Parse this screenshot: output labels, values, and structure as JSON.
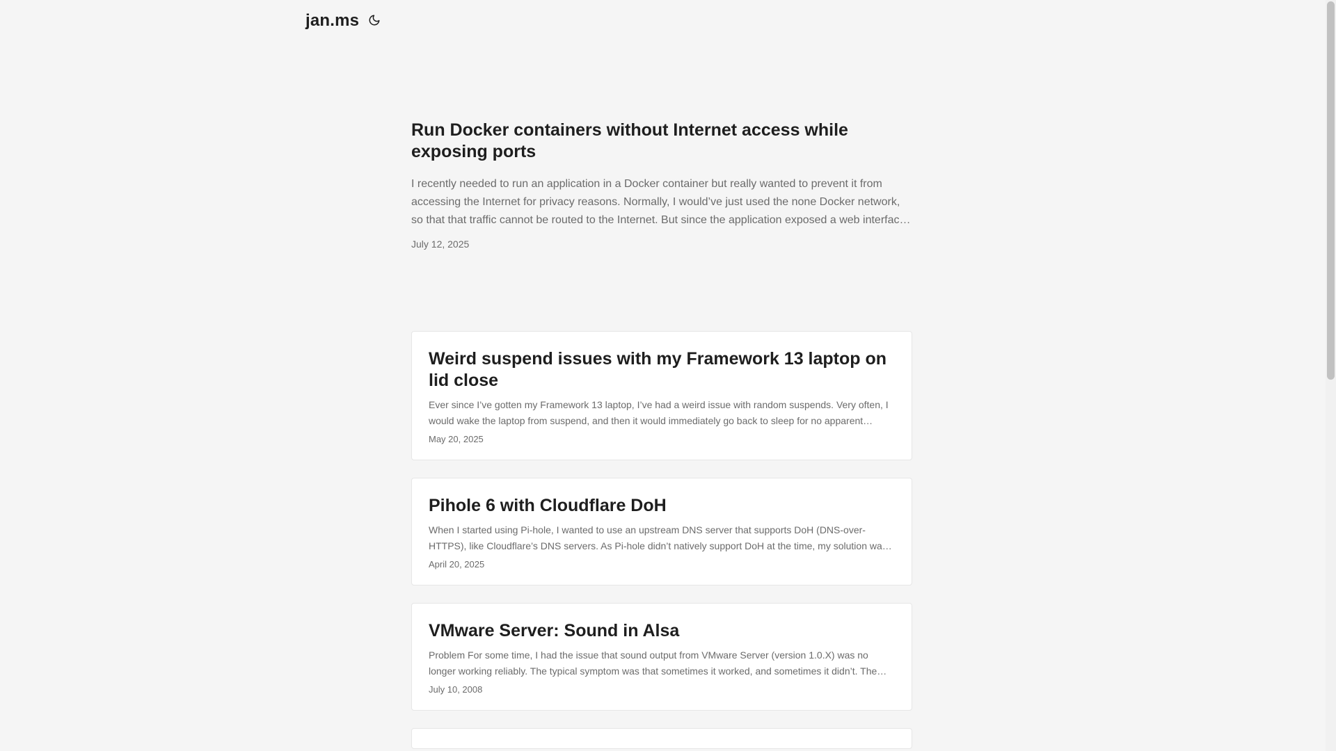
{
  "site": {
    "logo": "jan.ms",
    "theme_toggle_icon": "moon-icon"
  },
  "featured": {
    "title": "Run Docker containers without Internet access while exposing ports",
    "excerpt": "I recently needed to run an application in a Docker container but really wanted to prevent it from accessing the Internet for privacy reasons. Normally, I would’ve just used the none Docker network, so that that traffic cannot be routed to the Internet. But since the application exposed a web interface that I wanted to access, this was not an option.",
    "date": "July 12, 2025"
  },
  "posts": [
    {
      "title": "Weird suspend issues with my Framework 13 laptop on lid close",
      "excerpt": "Ever since I’ve gotten my Framework 13 laptop, I’ve had a weird issue with random suspends. Very often, I would wake the laptop from suspend, and then it would immediately go back to sleep for no apparent reason.",
      "date": "May 20, 2025"
    },
    {
      "title": "Pihole 6 with Cloudflare DoH",
      "excerpt": "When I started using Pi-hole, I wanted to use an upstream DNS server that supports DoH (DNS-over-HTTPS), like Cloudflare’s DNS servers. As Pi-hole didn’t natively support DoH at the time, my solution was to use cloudflared.",
      "date": "April 20, 2025"
    },
    {
      "title": "VMware Server: Sound in Alsa",
      "excerpt": "Problem For some time, I had the issue that sound output from VMware Server (version 1.0.X) was no longer working reliably. The typical symptom was that sometimes it worked, and sometimes it didn’t. The reason was that another application was already using the sound device.",
      "date": "July 10, 2008"
    }
  ]
}
